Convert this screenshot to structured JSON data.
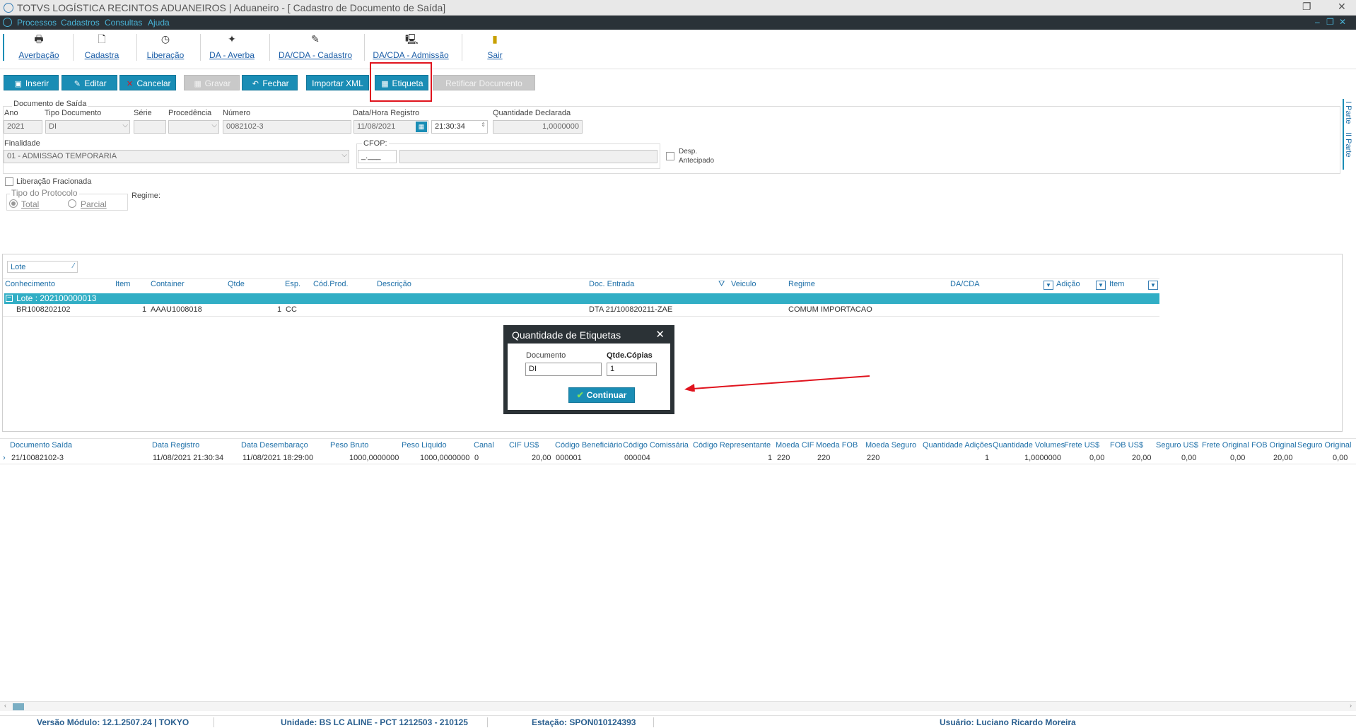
{
  "window": {
    "title": "TOTVS LOGÍSTICA RECINTOS ADUANEIROS | Aduaneiro - [ Cadastro de Documento de Saída]"
  },
  "menu": {
    "items": [
      "Processos",
      "Cadastros",
      "Consultas",
      "Ajuda"
    ]
  },
  "bigtoolbar": {
    "items": [
      "Averbação",
      "Cadastra",
      "Liberação",
      "DA - Averba",
      "DA/CDA - Cadastro",
      "DA/CDA - Admissão",
      "Sair"
    ]
  },
  "actions": {
    "inserir": "Inserir",
    "editar": "Editar",
    "cancelar": "Cancelar",
    "gravar": "Gravar",
    "fechar": "Fechar",
    "importar_xml": "Importar XML",
    "etiqueta": "Etiqueta",
    "retificar": "Retificar Documento"
  },
  "form": {
    "group_title": "Documento de Saída",
    "ano_label": "Ano",
    "ano": "2021",
    "tipo_label": "Tipo Documento",
    "tipo": "DI",
    "serie_label": "Série",
    "serie": "",
    "procedencia_label": "Procedência",
    "procedencia": "",
    "numero_label": "Número",
    "numero": "0082102-3",
    "data_label": "Data/Hora Registro",
    "data": "11/08/2021",
    "hora": "21:30:34",
    "qtd_label": "Quantidade Declarada",
    "qtd": "1,0000000",
    "finalidade_label": "Finalidade",
    "finalidade": "01 - ADMISSAO TEMPORARIA",
    "cfop_label": "CFOP:",
    "cfop": "_.___",
    "cfop_desc": "",
    "desp_label_1": "Desp.",
    "desp_label_2": "Antecipado",
    "lib_frac_label": "Liberação Fracionada",
    "tipo_protocolo_label": "Tipo do Protocolo",
    "total_label": "Total",
    "parcial_label": "Parcial",
    "regime_label": "Regime:"
  },
  "side_tabs": [
    "I Parte",
    "II Parte"
  ],
  "grid": {
    "group_by": "Lote",
    "columns": [
      "Conhecimento",
      "Item",
      "Container",
      "Qtde",
      "Esp.",
      "Cód.Prod.",
      "Descrição",
      "Doc. Entrada",
      "Veiculo",
      "Regime",
      "DA/CDA",
      "Adição",
      "Item"
    ],
    "group_row": "Lote : 202100000013",
    "rows": [
      {
        "conhecimento": "BR1008202102",
        "item": "1",
        "container": "AAAU1008018",
        "qtde": "1",
        "esp": "CC",
        "cod_prod": "",
        "descricao": "",
        "doc_entrada": "DTA 21/100820211-ZAE",
        "veiculo": "",
        "regime": "COMUM IMPORTACAO",
        "da_cda": "",
        "adicao": "",
        "item2": ""
      }
    ]
  },
  "dialog": {
    "title": "Quantidade de Etiquetas",
    "documento_label": "Documento",
    "documento": "DI",
    "copias_label": "Qtde.Cópias",
    "copias": "1",
    "continuar": "Continuar"
  },
  "bottom_table": {
    "columns": [
      "Documento Saída",
      "Data Registro",
      "Data  Desembaraço",
      "Peso Bruto",
      "Peso Liquido",
      "Canal",
      "CIF US$",
      "Código Beneficiário",
      "Código Comissária",
      "Código Representante",
      "Moeda CIF",
      "Moeda FOB",
      "Moeda Seguro",
      "Quantidade Adições",
      "Quantidade Volumes",
      "Frete US$",
      "FOB US$",
      "Seguro US$",
      "Frete Original",
      "FOB Original",
      "Seguro Original"
    ],
    "row": [
      "21/10082102-3",
      "11/08/2021 21:30:34",
      "11/08/2021 18:29:00",
      "1000,0000000",
      "1000,0000000",
      "0",
      "20,00",
      "000001",
      "000004",
      "1",
      "220",
      "220",
      "220",
      "1",
      "1,0000000",
      "0,00",
      "20,00",
      "0,00",
      "0,00",
      "20,00",
      "0,00"
    ]
  },
  "status": {
    "versao": "Versão Módulo:  12.1.2507.24  |  TOKYO",
    "unidade": "Unidade: BS LC ALINE - PCT 1212503 - 210125",
    "estacao": "Estação: SPON010124393",
    "usuario": "Usuário: Luciano Ricardo Moreira"
  },
  "colors": {
    "accent": "#1a8db5",
    "group_row": "#31aec5",
    "menu_bg": "#2a3238",
    "highlight": "#e0141e"
  }
}
